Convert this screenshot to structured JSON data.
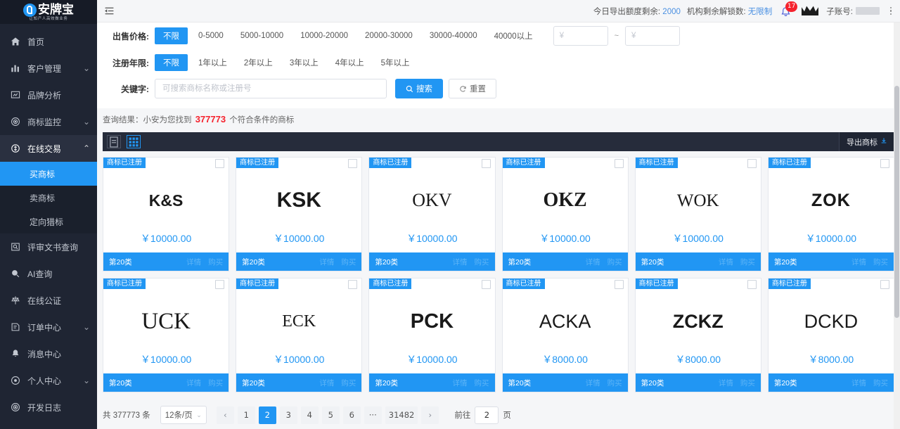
{
  "brand": {
    "name": "安牌宝",
    "tagline": "让知产人高效做业务",
    "logo_icon": "p-circle-logo"
  },
  "sidebar": {
    "items": [
      {
        "label": "首页",
        "icon": "home-icon",
        "arrow": ""
      },
      {
        "label": "客户管理",
        "icon": "bar-chart-icon",
        "arrow": "⌄"
      },
      {
        "label": "品牌分析",
        "icon": "monitor-icon",
        "arrow": ""
      },
      {
        "label": "商标监控",
        "icon": "target-icon",
        "arrow": "⌄"
      },
      {
        "label": "在线交易",
        "icon": "deal-icon",
        "arrow": "⌃",
        "expanded": true
      },
      {
        "label": "评审文书查询",
        "icon": "doc-search-icon",
        "arrow": ""
      },
      {
        "label": "AI查询",
        "icon": "ai-search-icon",
        "arrow": ""
      },
      {
        "label": "在线公证",
        "icon": "notary-icon",
        "arrow": ""
      },
      {
        "label": "订单中心",
        "icon": "order-icon",
        "arrow": "⌄"
      },
      {
        "label": "消息中心",
        "icon": "bell-icon",
        "arrow": ""
      },
      {
        "label": "个人中心",
        "icon": "user-gear-icon",
        "arrow": "⌄"
      },
      {
        "label": "开发日志",
        "icon": "log-icon",
        "arrow": ""
      }
    ],
    "submenu": [
      {
        "label": "买商标",
        "active": true
      },
      {
        "label": "卖商标",
        "active": false
      },
      {
        "label": "定向猎标",
        "active": false
      }
    ]
  },
  "topbar": {
    "fold_icon": "menu-fold-icon",
    "quota_label": "今日导出额度剩余:",
    "quota_value": "2000",
    "unlock_label": "机构剩余解锁数:",
    "unlock_value": "无限制",
    "bell_icon": "bell-icon",
    "bell_badge": "17",
    "crown_icon": "crown-icon",
    "subaccount_label": "子账号:",
    "more_icon": "more-vertical-icon"
  },
  "filters": {
    "price": {
      "label": "出售价格:",
      "options": [
        "不限",
        "0-5000",
        "5000-10000",
        "10000-20000",
        "20000-30000",
        "30000-40000",
        "40000以上"
      ],
      "selected": "不限",
      "min_placeholder": "¥",
      "max_placeholder": "¥",
      "min_value": "",
      "max_value": "",
      "separator": "~"
    },
    "years": {
      "label": "注册年限:",
      "options": [
        "不限",
        "1年以上",
        "2年以上",
        "3年以上",
        "4年以上",
        "5年以上"
      ],
      "selected": "不限"
    },
    "keyword": {
      "label": "关键字:",
      "placeholder": "可搜索商标名称或注册号",
      "value": "",
      "search_button": "搜索",
      "search_icon": "search-icon",
      "reset_button": "重置",
      "reset_icon": "refresh-icon"
    }
  },
  "result": {
    "prefix": "查询结果：小安为您找到",
    "count": "377773",
    "suffix": "个符合条件的商标"
  },
  "toolbar": {
    "list_view_icon": "list-view-icon",
    "grid_view_icon": "grid-view-icon",
    "export_label": "导出商标",
    "export_icon": "export-icon"
  },
  "cards": [
    {
      "badge": "商标已注册",
      "mark": "K&S",
      "style": "sans",
      "size": 23,
      "weight": "bold",
      "price": "￥10000.00",
      "category": "第20类",
      "action1": "详情",
      "action2": "购买"
    },
    {
      "badge": "商标已注册",
      "mark": "KSK",
      "style": "sans",
      "size": 30,
      "weight": "bold",
      "price": "￥10000.00",
      "category": "第20类",
      "action1": "详情",
      "action2": "购买"
    },
    {
      "badge": "商标已注册",
      "mark": "OKV",
      "style": "serif",
      "size": 26,
      "weight": "normal",
      "price": "￥10000.00",
      "category": "第20类",
      "action1": "详情",
      "action2": "购买"
    },
    {
      "badge": "商标已注册",
      "mark": "OKZ",
      "style": "serif",
      "size": 28,
      "weight": "bold",
      "price": "￥10000.00",
      "category": "第20类",
      "action1": "详情",
      "action2": "购买"
    },
    {
      "badge": "商标已注册",
      "mark": "WOK",
      "style": "serif",
      "size": 25,
      "weight": "normal",
      "price": "￥10000.00",
      "category": "第20类",
      "action1": "详情",
      "action2": "购买"
    },
    {
      "badge": "商标已注册",
      "mark": "ZOK",
      "style": "dotted",
      "size": 25,
      "weight": "bold",
      "price": "￥10000.00",
      "category": "第20类",
      "action1": "详情",
      "action2": "购买"
    },
    {
      "badge": "商标已注册",
      "mark": "UCK",
      "style": "serif",
      "size": 33,
      "weight": "normal",
      "price": "￥10000.00",
      "category": "第20类",
      "action1": "详情",
      "action2": "购买"
    },
    {
      "badge": "商标已注册",
      "mark": "ECK",
      "style": "serif",
      "size": 24,
      "weight": "normal",
      "price": "￥10000.00",
      "category": "第20类",
      "action1": "详情",
      "action2": "购买"
    },
    {
      "badge": "商标已注册",
      "mark": "PCK",
      "style": "sans",
      "size": 29,
      "weight": "bold",
      "price": "￥10000.00",
      "category": "第20类",
      "action1": "详情",
      "action2": "购买"
    },
    {
      "badge": "商标已注册",
      "mark": "ACKA",
      "style": "sans",
      "size": 27,
      "weight": "normal",
      "price": "￥8000.00",
      "category": "第20类",
      "action1": "详情",
      "action2": "购买"
    },
    {
      "badge": "商标已注册",
      "mark": "ZCKZ",
      "style": "sans",
      "size": 27,
      "weight": "bold",
      "price": "￥8000.00",
      "category": "第20类",
      "action1": "详情",
      "action2": "购买"
    },
    {
      "badge": "商标已注册",
      "mark": "DCKD",
      "style": "sans",
      "size": 27,
      "weight": "normal",
      "price": "￥8000.00",
      "category": "第20类",
      "action1": "详情",
      "action2": "购买"
    }
  ],
  "pagination": {
    "total_text": "共 377773 条",
    "page_size": "12条/页",
    "prev_icon": "‹",
    "next_icon": "›",
    "pages": [
      "1",
      "2",
      "3",
      "4",
      "5",
      "6",
      "···",
      "31482"
    ],
    "current": "2",
    "jump_prefix": "前往",
    "jump_value": "2",
    "jump_suffix": "页"
  },
  "colors": {
    "accent": "#2196f3",
    "sidebar_bg": "#1f2533",
    "danger": "#f5222d",
    "toolbar_bg": "#262c3b"
  }
}
